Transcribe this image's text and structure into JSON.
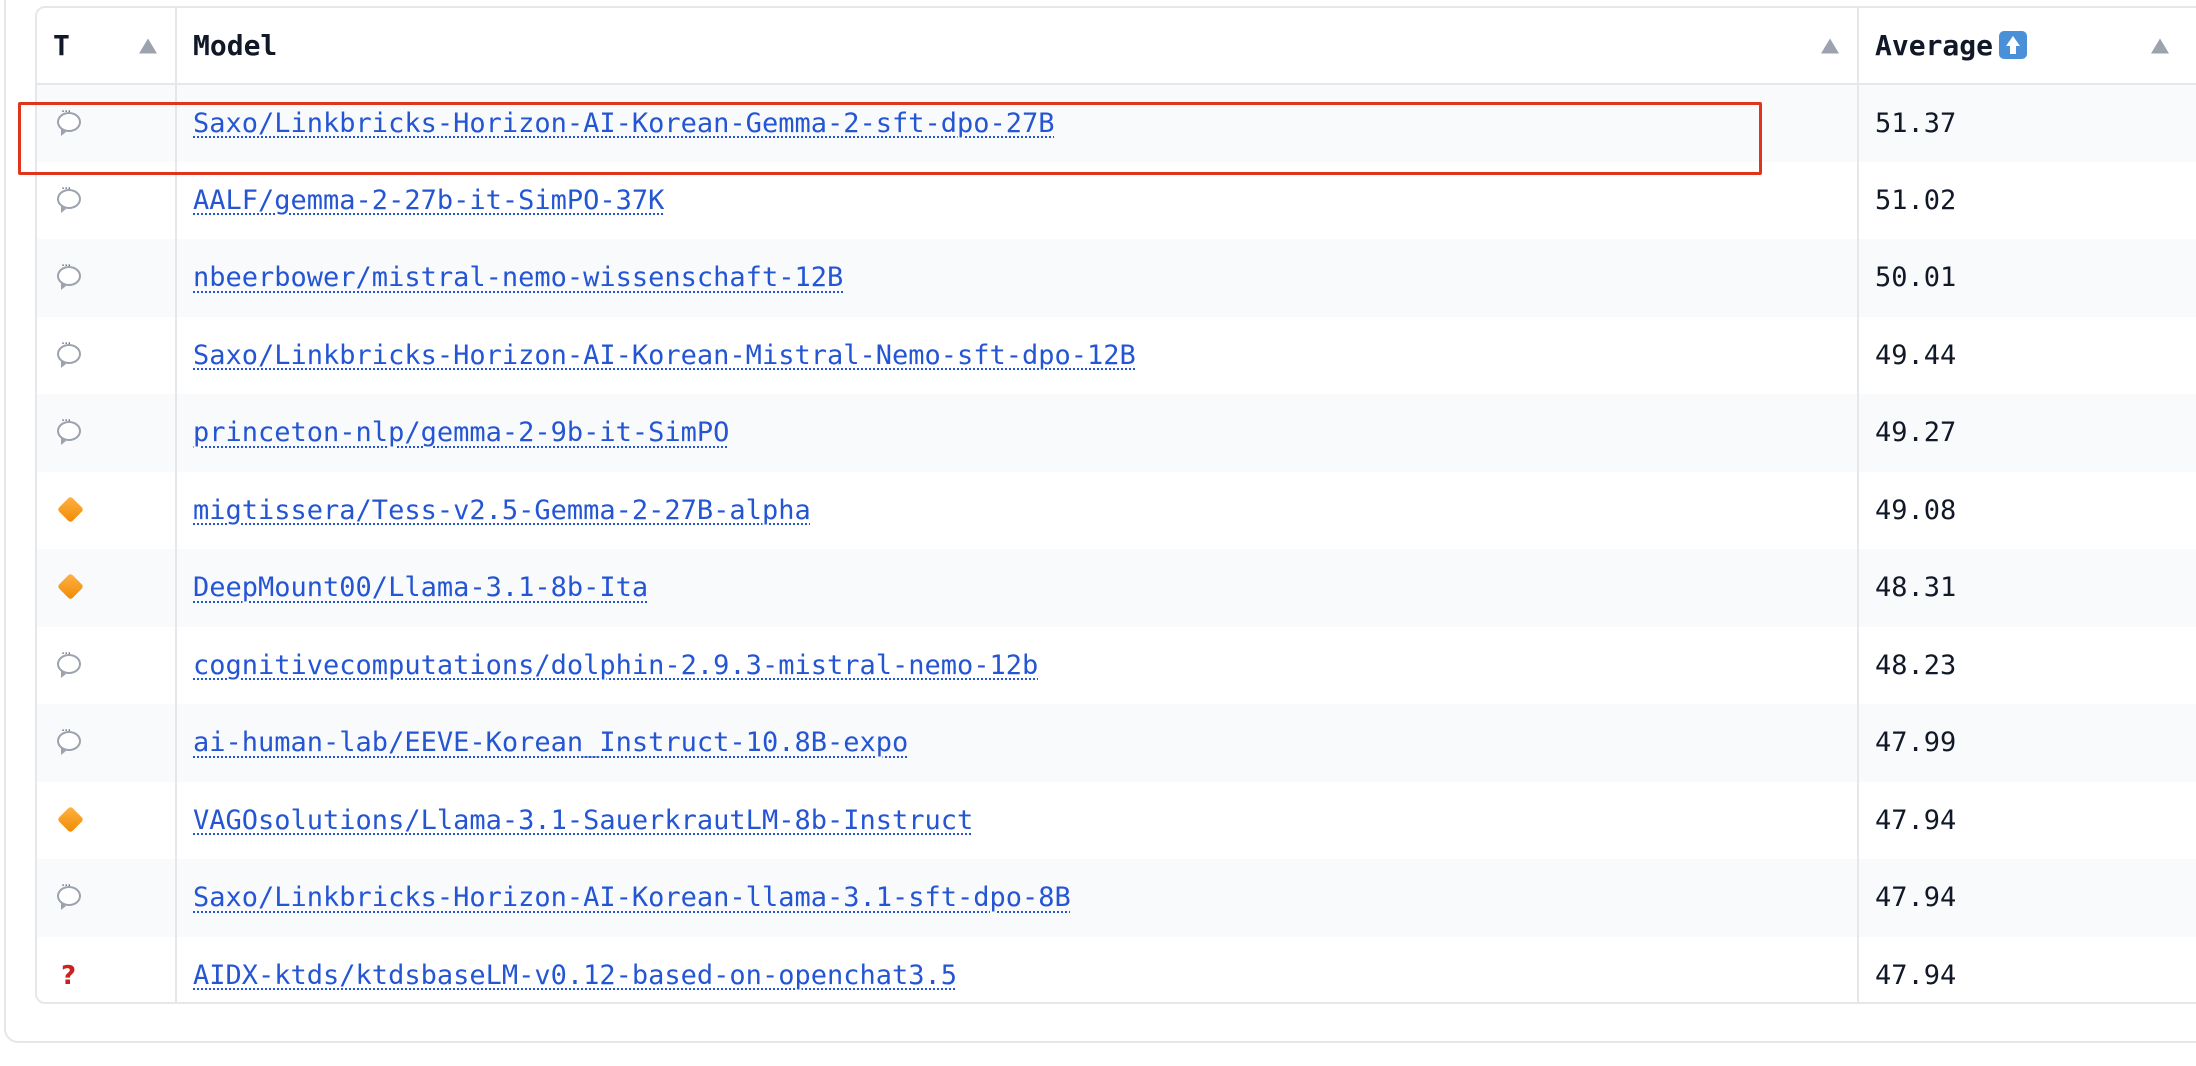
{
  "table": {
    "columns": [
      {
        "label": "T"
      },
      {
        "label": "Model"
      },
      {
        "label": "Average",
        "icon": "up-arrow-emoji-icon"
      }
    ],
    "rows": [
      {
        "type": "chat-icon",
        "model": "Saxo/Linkbricks-Horizon-AI-Korean-Gemma-2-sft-dpo-27B",
        "average": "51.37",
        "highlighted": true
      },
      {
        "type": "chat-icon",
        "model": "AALF/gemma-2-27b-it-SimPO-37K",
        "average": "51.02"
      },
      {
        "type": "chat-icon",
        "model": "nbeerbower/mistral-nemo-wissenschaft-12B",
        "average": "50.01"
      },
      {
        "type": "chat-icon",
        "model": "Saxo/Linkbricks-Horizon-AI-Korean-Mistral-Nemo-sft-dpo-12B",
        "average": "49.44"
      },
      {
        "type": "chat-icon",
        "model": "princeton-nlp/gemma-2-9b-it-SimPO",
        "average": "49.27"
      },
      {
        "type": "diamond-icon",
        "model": "migtissera/Tess-v2.5-Gemma-2-27B-alpha",
        "average": "49.08"
      },
      {
        "type": "diamond-icon",
        "model": "DeepMount00/Llama-3.1-8b-Ita",
        "average": "48.31"
      },
      {
        "type": "chat-icon",
        "model": "cognitivecomputations/dolphin-2.9.3-mistral-nemo-12b",
        "average": "48.23"
      },
      {
        "type": "chat-icon",
        "model": "ai-human-lab/EEVE-Korean_Instruct-10.8B-expo",
        "average": "47.99"
      },
      {
        "type": "diamond-icon",
        "model": "VAGOsolutions/Llama-3.1-SauerkrautLM-8b-Instruct",
        "average": "47.94"
      },
      {
        "type": "chat-icon",
        "model": "Saxo/Linkbricks-Horizon-AI-Korean-llama-3.1-sft-dpo-8B",
        "average": "47.94"
      },
      {
        "type": "question-mark-icon",
        "glyph": "?",
        "model": "AIDX-ktds/ktdsbaseLM-v0.12-based-on-openchat3.5",
        "average": "47.94"
      }
    ]
  },
  "colors": {
    "link": "#2455d3",
    "highlight_border": "#e0351c",
    "diamond": "#f59a1c",
    "question_mark": "#cc1f1f"
  }
}
